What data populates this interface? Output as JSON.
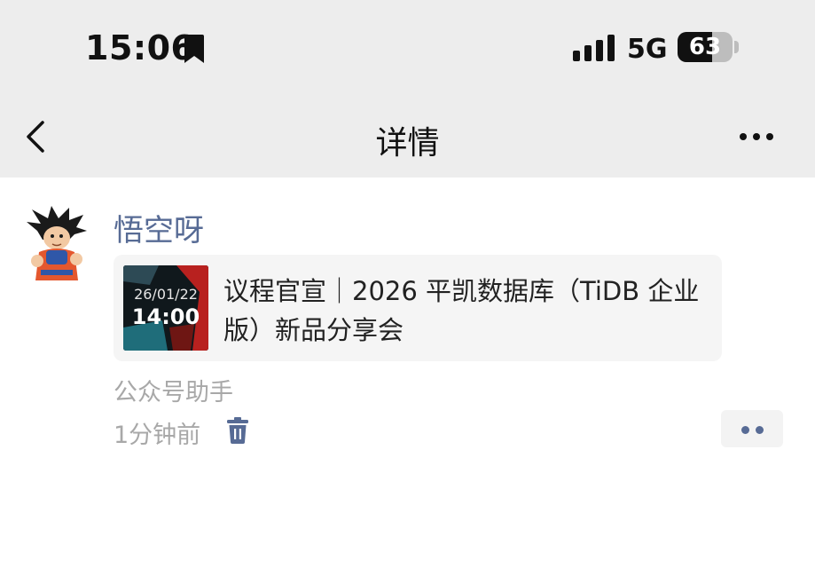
{
  "status_bar": {
    "time": "15:06",
    "network": "5G",
    "battery": "63",
    "battery_level": 0.63
  },
  "nav": {
    "title": "详情",
    "back_icon": "chevron-left-icon",
    "more_icon": "more-horizontal-icon"
  },
  "post": {
    "username": "悟空呀",
    "card": {
      "thumb_date": "26/01/22",
      "thumb_time": "14:00",
      "title": "议程官宣｜2026 平凯数据库（TiDB 企业版）新品分享会"
    },
    "source": "公众号助手",
    "time_ago": "1分钟前",
    "delete_icon": "trash-icon",
    "action_icon": "two-dots-icon"
  },
  "colors": {
    "link_blue": "#576b95",
    "header_bg": "#ededed",
    "card_bg": "#f5f5f5",
    "muted_text": "#a8a8a8"
  }
}
